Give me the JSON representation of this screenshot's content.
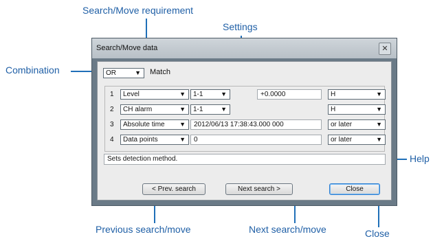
{
  "callouts": {
    "search_move_requirement": "Search/Move requirement",
    "settings": "Settings",
    "combination": "Combination",
    "help": "Help",
    "previous_search_move": "Previous search/move",
    "next_search_move": "Next search/move",
    "close": "Close"
  },
  "dialog": {
    "title": "Search/Move data",
    "combination": {
      "value": "OR",
      "label": "Match"
    },
    "rows": [
      {
        "num": "1",
        "type": "Level",
        "channel": "1-1",
        "value": "+0.0000",
        "condition": "H"
      },
      {
        "num": "2",
        "type": "CH alarm",
        "channel": "1-1",
        "condition": "H"
      },
      {
        "num": "3",
        "type": "Absolute time",
        "value": "2012/06/13 17:38:43.000 000",
        "condition": "or later"
      },
      {
        "num": "4",
        "type": "Data points",
        "value": "0",
        "condition": "or later"
      }
    ],
    "help_text": "Sets detection method.",
    "buttons": {
      "prev": "< Prev. search",
      "next": "Next search >",
      "close": "Close"
    }
  },
  "colors": {
    "callout": "#1f5fa6",
    "window_frame": "#6a7a87",
    "default_button_border": "#2f7fd1"
  },
  "icons": {
    "dropdown": "chevron-down-icon",
    "window_close": "close-icon"
  }
}
